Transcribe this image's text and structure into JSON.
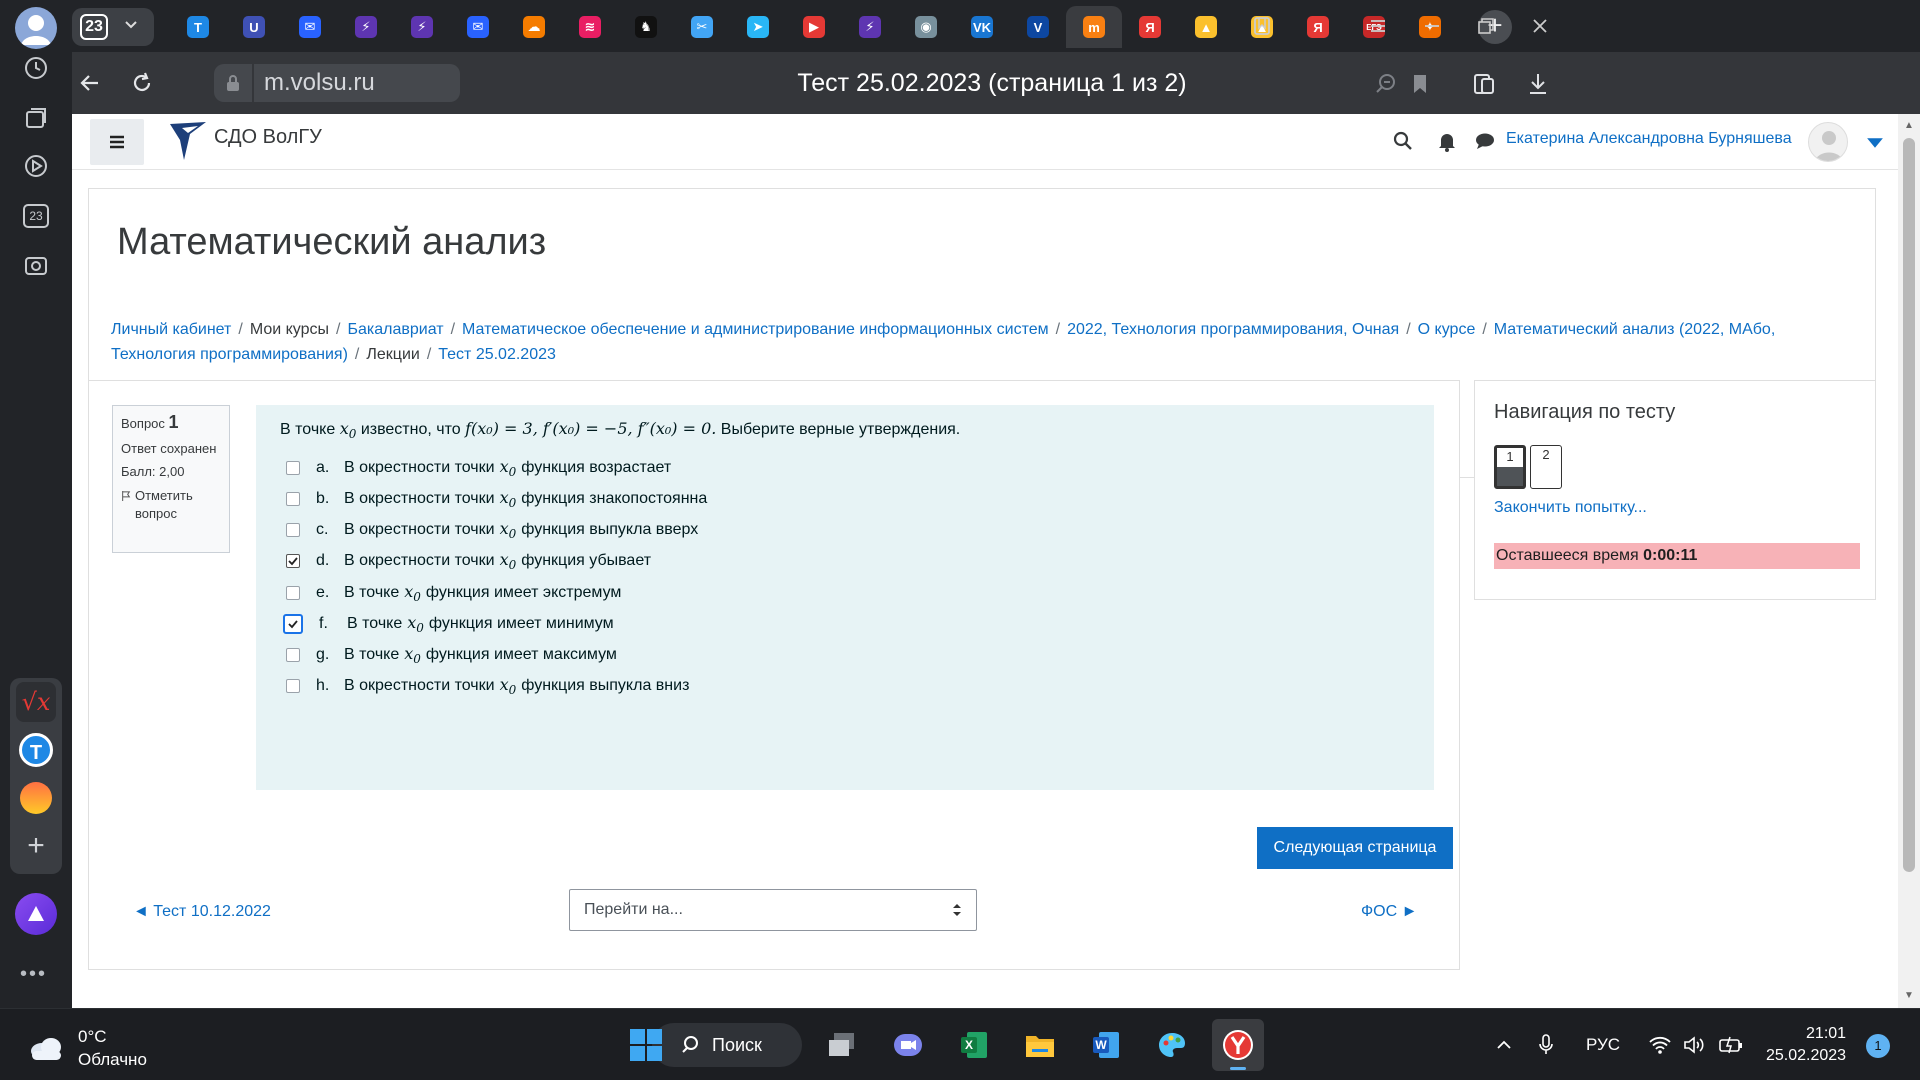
{
  "browser": {
    "tab_count": "23",
    "url": "m.volsu.ru",
    "page_title": "Тест 25.02.2023 (страница 1 из 2)",
    "sidebar_badge": "23",
    "tabs": [
      {
        "icon": "tinkoff-icon",
        "color": "#1e88e5",
        "glyph": "Т"
      },
      {
        "icon": "shield-icon",
        "color": "#3f51b5",
        "glyph": "U"
      },
      {
        "icon": "mail-icon",
        "color": "#2962ff",
        "glyph": "✉"
      },
      {
        "icon": "bolt-icon",
        "color": "#5e35b1",
        "glyph": "⚡"
      },
      {
        "icon": "bolt-icon",
        "color": "#5e35b1",
        "glyph": "⚡"
      },
      {
        "icon": "mail-icon",
        "color": "#2962ff",
        "glyph": "✉"
      },
      {
        "icon": "cloud-icon",
        "color": "#f57c00",
        "glyph": "☁"
      },
      {
        "icon": "wifi-icon",
        "color": "#e91e63",
        "glyph": "≋"
      },
      {
        "icon": "person-icon",
        "color": "#111111",
        "glyph": "♞"
      },
      {
        "icon": "scissors-icon",
        "color": "#42a5f5",
        "glyph": "✂"
      },
      {
        "icon": "telegram-icon",
        "color": "#29b6f6",
        "glyph": "➤"
      },
      {
        "icon": "youtube-icon",
        "color": "#e53935",
        "glyph": "▶"
      },
      {
        "icon": "bolt-icon",
        "color": "#5e35b1",
        "glyph": "⚡"
      },
      {
        "icon": "globe-icon",
        "color": "#78909c",
        "glyph": "◉"
      },
      {
        "icon": "vk-icon",
        "color": "#1976d2",
        "glyph": "VK"
      },
      {
        "icon": "volsu-icon",
        "color": "#0d47a1",
        "glyph": "V"
      },
      {
        "icon": "moodle-icon",
        "color": "#f98012",
        "glyph": "m",
        "active": true
      },
      {
        "icon": "yandex-icon",
        "color": "#e53935",
        "glyph": "Я"
      },
      {
        "icon": "image-icon",
        "color": "#fbc02d",
        "glyph": "▲"
      },
      {
        "icon": "image-icon",
        "color": "#fbc02d",
        "glyph": "▲"
      },
      {
        "icon": "yandex-icon",
        "color": "#e53935",
        "glyph": "Я"
      },
      {
        "icon": "ege-icon",
        "color": "#c62828",
        "glyph": "ЕГЭ"
      },
      {
        "icon": "fox-icon",
        "color": "#ef6c00",
        "glyph": "✦"
      }
    ]
  },
  "site": {
    "name": "СДО ВолГУ",
    "user_name": "Екатерина Александровна Бурняшева"
  },
  "course": {
    "title": "Математический анализ",
    "breadcrumb": [
      {
        "label": "Личный кабинет",
        "link": true
      },
      {
        "label": "Мои курсы",
        "link": false
      },
      {
        "label": "Бакалавриат",
        "link": true
      },
      {
        "label": "Математическое обеспечение и администрирование информационных систем",
        "link": true
      },
      {
        "label": "2022, Технология программирования, Очная",
        "link": true
      },
      {
        "label": "О курсе",
        "link": true
      },
      {
        "label": "Математический анализ (2022, МАбо, Технология программирования)",
        "link": true
      },
      {
        "label": "Лекции",
        "link": false
      },
      {
        "label": "Тест 25.02.2023",
        "link": true
      }
    ]
  },
  "question": {
    "label": "Вопрос",
    "number": "1",
    "state": "Ответ сохранен",
    "grade": "Балл: 2,00",
    "flag_label": "Отметить вопрос",
    "text_prefix": "В точке",
    "text_mid": "известно, что",
    "condition": "f(x₀) = 3,  f′(x₀) = −5,  f″(x₀) = 0.",
    "text_suffix": "Выберите верные утверждения.",
    "answers": [
      {
        "letter": "a.",
        "pre": "В окрестности точки",
        "post": "функция возрастает",
        "checked": false
      },
      {
        "letter": "b.",
        "pre": "В окрестности точки",
        "post": "функция знакопостоянна",
        "checked": false
      },
      {
        "letter": "c.",
        "pre": "В окрестности точки",
        "post": "функция выпукла вверх",
        "checked": false
      },
      {
        "letter": "d.",
        "pre": "В окрестности точки",
        "post": "функция убывает",
        "checked": true
      },
      {
        "letter": "e.",
        "pre": "В точке",
        "post": "функция имеет экстремум",
        "checked": false
      },
      {
        "letter": "f.",
        "pre": "В точке",
        "post": "функция имеет минимум",
        "checked": true,
        "focused": true
      },
      {
        "letter": "g.",
        "pre": "В точке",
        "post": "функция имеет максимум",
        "checked": false
      },
      {
        "letter": "h.",
        "pre": "В окрестности точки",
        "post": "функция выпукла вниз",
        "checked": false
      }
    ],
    "next_page_label": "Следующая страница",
    "prev_activity": "◄ Тест 10.12.2022",
    "jump_placeholder": "Перейти на...",
    "next_activity": "ФОС ►"
  },
  "quiz_nav": {
    "title": "Навигация по тесту",
    "buttons": [
      {
        "label": "1",
        "answered": true,
        "current": true
      },
      {
        "label": "2",
        "answered": false,
        "current": false
      }
    ],
    "finish_label": "Закончить попытку...",
    "time_label": "Оставшееся время",
    "time_value": "0:00:11"
  },
  "taskbar": {
    "temperature": "0°C",
    "weather": "Облачно",
    "search_label": "Поиск",
    "language": "РУС",
    "time": "21:01",
    "date": "25.02.2023",
    "notifications": "1"
  }
}
